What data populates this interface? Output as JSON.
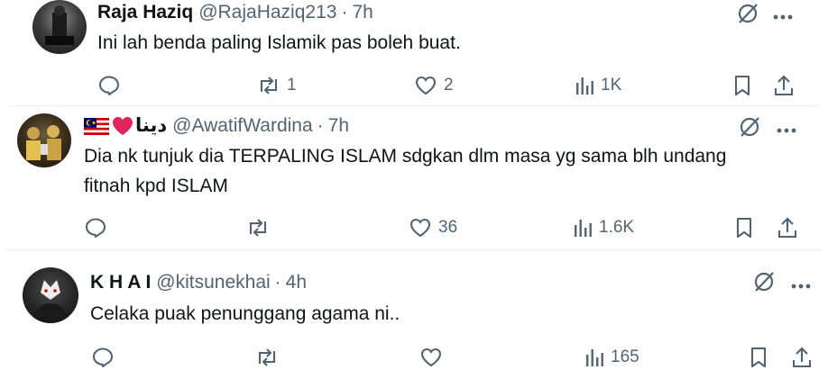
{
  "tweets": [
    {
      "name": "Raja Haziq",
      "handle": "@RajaHaziq213",
      "separator": "·",
      "time": "7h",
      "text": "Ini lah benda paling Islamik pas boleh buat.",
      "replies": "",
      "reposts": "1",
      "likes": "2",
      "views": "1K"
    },
    {
      "name_script": "دينا",
      "handle": "@AwatifWardina",
      "separator": "·",
      "time": "7h",
      "text_line1": "Dia nk tunjuk dia TERPALING ISLAM sdgkan dlm masa yg sama blh undang",
      "text_line2": "fitnah kpd ISLAM",
      "replies": "",
      "reposts": "",
      "likes": "36",
      "views": "1.6K"
    },
    {
      "name": "K H A I",
      "handle": "@kitsunekhai",
      "separator": "·",
      "time": "4h",
      "text": "Celaka puak penunggang agama ni..",
      "replies": "",
      "reposts": "",
      "likes": "",
      "views": "165"
    }
  ],
  "colors": {
    "text": "#0f1419",
    "muted": "#536471",
    "divider": "#eff3f4",
    "heart_red": "#e0245e"
  },
  "icons": [
    "reply-icon",
    "repost-icon",
    "like-icon",
    "views-icon",
    "bookmark-icon",
    "share-icon",
    "grok-icon",
    "more-icon",
    "malaysia-flag-icon",
    "red-heart-icon"
  ]
}
